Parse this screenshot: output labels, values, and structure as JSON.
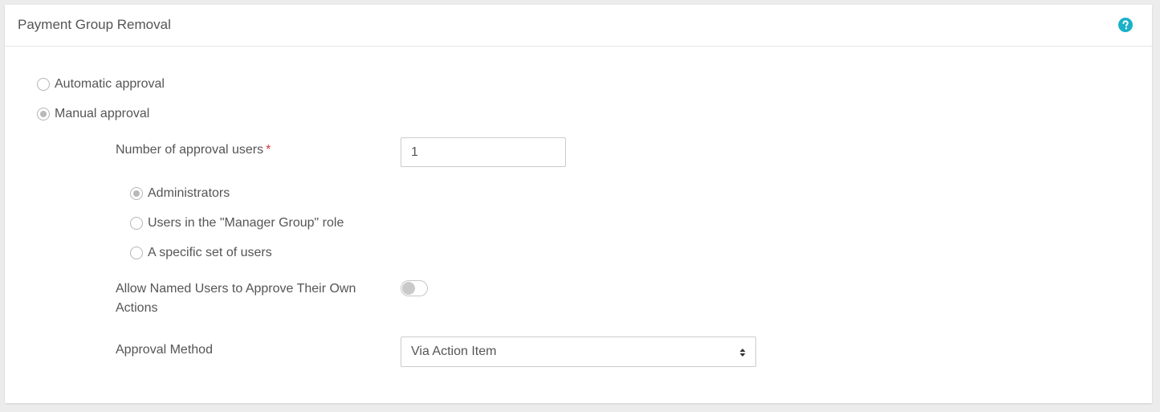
{
  "panel": {
    "title": "Payment Group Removal",
    "help_icon": "question-circle-icon",
    "accent_color": "#1ab0c8"
  },
  "approval_mode": {
    "options": [
      {
        "label": "Automatic approval",
        "checked": false
      },
      {
        "label": "Manual approval",
        "checked": true
      }
    ]
  },
  "approval_users": {
    "label": "Number of approval users",
    "required_marker": "*",
    "value": "1"
  },
  "approver_type": {
    "options": [
      {
        "label": "Administrators",
        "checked": true
      },
      {
        "label": "Users in the \"Manager Group\" role",
        "checked": false
      },
      {
        "label": "A specific set of users",
        "checked": false
      }
    ]
  },
  "self_approve": {
    "label": "Allow Named Users to Approve Their Own Actions",
    "enabled": false
  },
  "approval_method": {
    "label": "Approval Method",
    "selected": "Via Action Item"
  }
}
